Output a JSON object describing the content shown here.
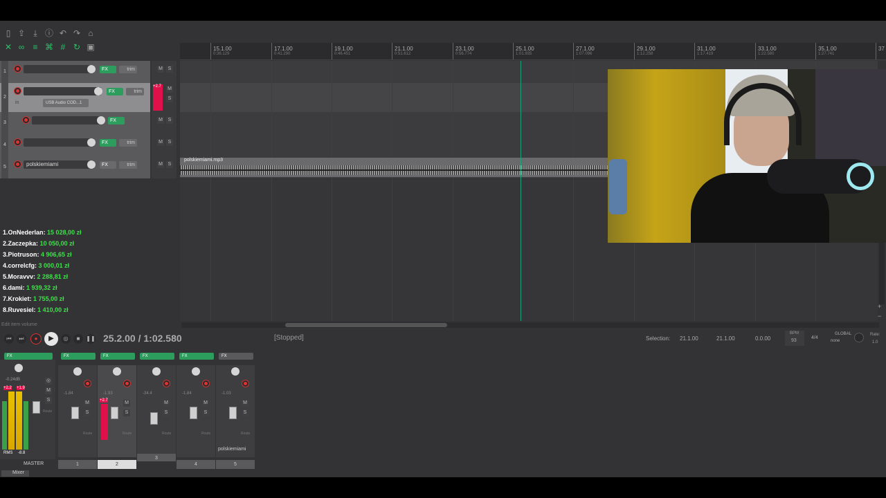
{
  "toolbar": {
    "icons_row1": [
      "new-project-icon",
      "open-project-icon",
      "save-project-icon",
      "project-settings-icon",
      "undo-icon",
      "redo-icon",
      "metronome-icon"
    ],
    "icons_row2": [
      "snap-icon",
      "ripple-icon",
      "grouping-icon",
      "auto-crossfade-icon",
      "grid-icon",
      "loop-icon",
      "lock-icon"
    ]
  },
  "ruler": {
    "markers": [
      {
        "bar": "15.1.00",
        "time": "0:36.129"
      },
      {
        "bar": "17.1.00",
        "time": "0:41.290"
      },
      {
        "bar": "19.1.00",
        "time": "0:46.451"
      },
      {
        "bar": "21.1.00",
        "time": "0:51.612"
      },
      {
        "bar": "23.1.00",
        "time": "0:56.774"
      },
      {
        "bar": "25.1.00",
        "time": "1:01.935"
      },
      {
        "bar": "27.1.00",
        "time": "1:07.096"
      },
      {
        "bar": "29.1.00",
        "time": "1:12.258"
      },
      {
        "bar": "31.1.00",
        "time": "1:17.419"
      },
      {
        "bar": "33.1.00",
        "time": "1:22.580"
      },
      {
        "bar": "35.1.00",
        "time": "1:27.741"
      },
      {
        "bar": "37",
        "time": ""
      }
    ]
  },
  "tracks": [
    {
      "num": "1",
      "name": "",
      "fx_label": "FX",
      "trim_label": "trim"
    },
    {
      "num": "2",
      "name": "",
      "fx_label": "FX",
      "trim_label": "trim",
      "input_label": "in",
      "input_device": "USB Audio COD...1",
      "peak": "+2.7"
    },
    {
      "num": "3",
      "name": "",
      "fx_label": "FX"
    },
    {
      "num": "4",
      "name": "",
      "fx_label": "FX",
      "trim_label": "trim"
    },
    {
      "num": "5",
      "name": "polskiemiami",
      "fx_label": "FX",
      "trim_label": "trim"
    }
  ],
  "ms_labels": {
    "mute": "M",
    "solo": "S"
  },
  "media_item": {
    "name": "polskiemiami.mp3"
  },
  "leaderboard": [
    {
      "rank": "1.",
      "name": "OnNederlan:",
      "amount": "15 028,00 zł"
    },
    {
      "rank": "2.",
      "name": "Zaczepka:",
      "amount": "10 050,00 zł"
    },
    {
      "rank": "3.",
      "name": "Piotruson:",
      "amount": "4 906,65 zł"
    },
    {
      "rank": "4.",
      "name": "correlcfg:",
      "amount": "3 000,01 zł"
    },
    {
      "rank": "5.",
      "name": "Moravvv:",
      "amount": "2 288,81 zł"
    },
    {
      "rank": "6.",
      "name": "dami:",
      "amount": "1 939,32 zł"
    },
    {
      "rank": "7.",
      "name": "Krokiet:",
      "amount": "1 755,00 zł"
    },
    {
      "rank": "8.",
      "name": "Ruvesiel:",
      "amount": "1 410,00 zł"
    }
  ],
  "status_hint": "Edit item volume",
  "transport": {
    "position": "25.2.00 / 1:02.580",
    "state": "[Stopped]",
    "selection_label": "Selection:",
    "selection_start": "21.1.00",
    "selection_end": "21.1.00",
    "selection_length": "0.0.00",
    "bpm_label": "BPM",
    "bpm": "93",
    "time_sig": "4/4",
    "global_label": "GLOBAL",
    "global_mode": "none",
    "rate_label": "Rate:",
    "rate": "1.0"
  },
  "mixer": {
    "master": {
      "label": "MASTER",
      "volume": "-0.24dB",
      "peak_l": "+2.2",
      "peak_r": "+1.9",
      "rms_label": "RMS",
      "rms_value": "-8.8",
      "fx_label": "FX"
    },
    "strips": [
      {
        "num": "1",
        "db": "-1.84",
        "fx_label": "FX",
        "name": ""
      },
      {
        "num": "2",
        "db": "-1.93",
        "peak": "+2.7",
        "fx_label": "FX",
        "name": ""
      },
      {
        "num": "3",
        "db": "-34.4",
        "fx_label": "FX",
        "name": ""
      },
      {
        "num": "4",
        "db": "-1.84",
        "fx_label": "FX",
        "name": ""
      },
      {
        "num": "5",
        "db": "-1.03",
        "fx_label": "FX",
        "name": "polskiemiami"
      }
    ],
    "route_label": "Route",
    "trim_label": "trim",
    "tab_label": "Mixer"
  },
  "colors": {
    "fx_green": "#2d9d5e",
    "accent_red": "#e0104a",
    "amount_green": "#3ee04a",
    "playhead": "#1fa37a"
  }
}
